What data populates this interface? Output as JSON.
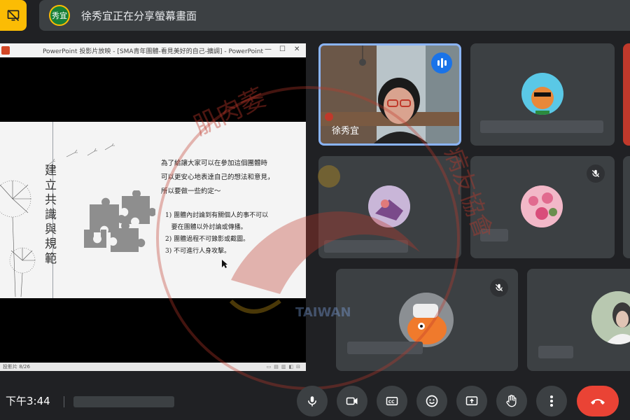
{
  "banner": {
    "presenter_initials": "秀宜",
    "sharing_text": "徐秀宜正在分享螢幕畫面"
  },
  "presentation": {
    "window_title": "PowerPoint 投影片放映 - [SMA青年團體-看見美好的自己-擴調] - PowerPoint",
    "slide": {
      "vertical_title": "建立共識與規範",
      "intro_lines": [
        "為了給讓大家可以在參加這個團體時",
        "可以更安心地表達自己的想法和意見，",
        "所以要做一些約定～"
      ],
      "rules": [
        "1) 團體內討論到有關個人的事不可以",
        "   要在團體以外討論或傳播。",
        "2) 團體過程不可錄影或截圖。",
        "3) 不可進行人身攻擊。"
      ]
    },
    "status_text": "投影片 8/26"
  },
  "participants": {
    "speaker_name": "徐秀宜"
  },
  "bottom_bar": {
    "time": "下午3:44"
  },
  "watermark": {
    "text_upper": "肌肉萎",
    "text_right": "病友協會",
    "logo_text": "TAIWAN"
  },
  "colors": {
    "accent_yellow": "#fbbc04",
    "active_border": "#8ab4f8",
    "end_call_red": "#ea4335",
    "tile_bg": "#3c4043",
    "page_bg": "#202124"
  },
  "icons": [
    "present-off-icon",
    "mic-icon",
    "camera-icon",
    "captions-icon",
    "emoji-icon",
    "present-screen-icon",
    "raise-hand-icon",
    "more-options-icon",
    "end-call-icon",
    "mic-off-icon",
    "speaking-icon"
  ]
}
